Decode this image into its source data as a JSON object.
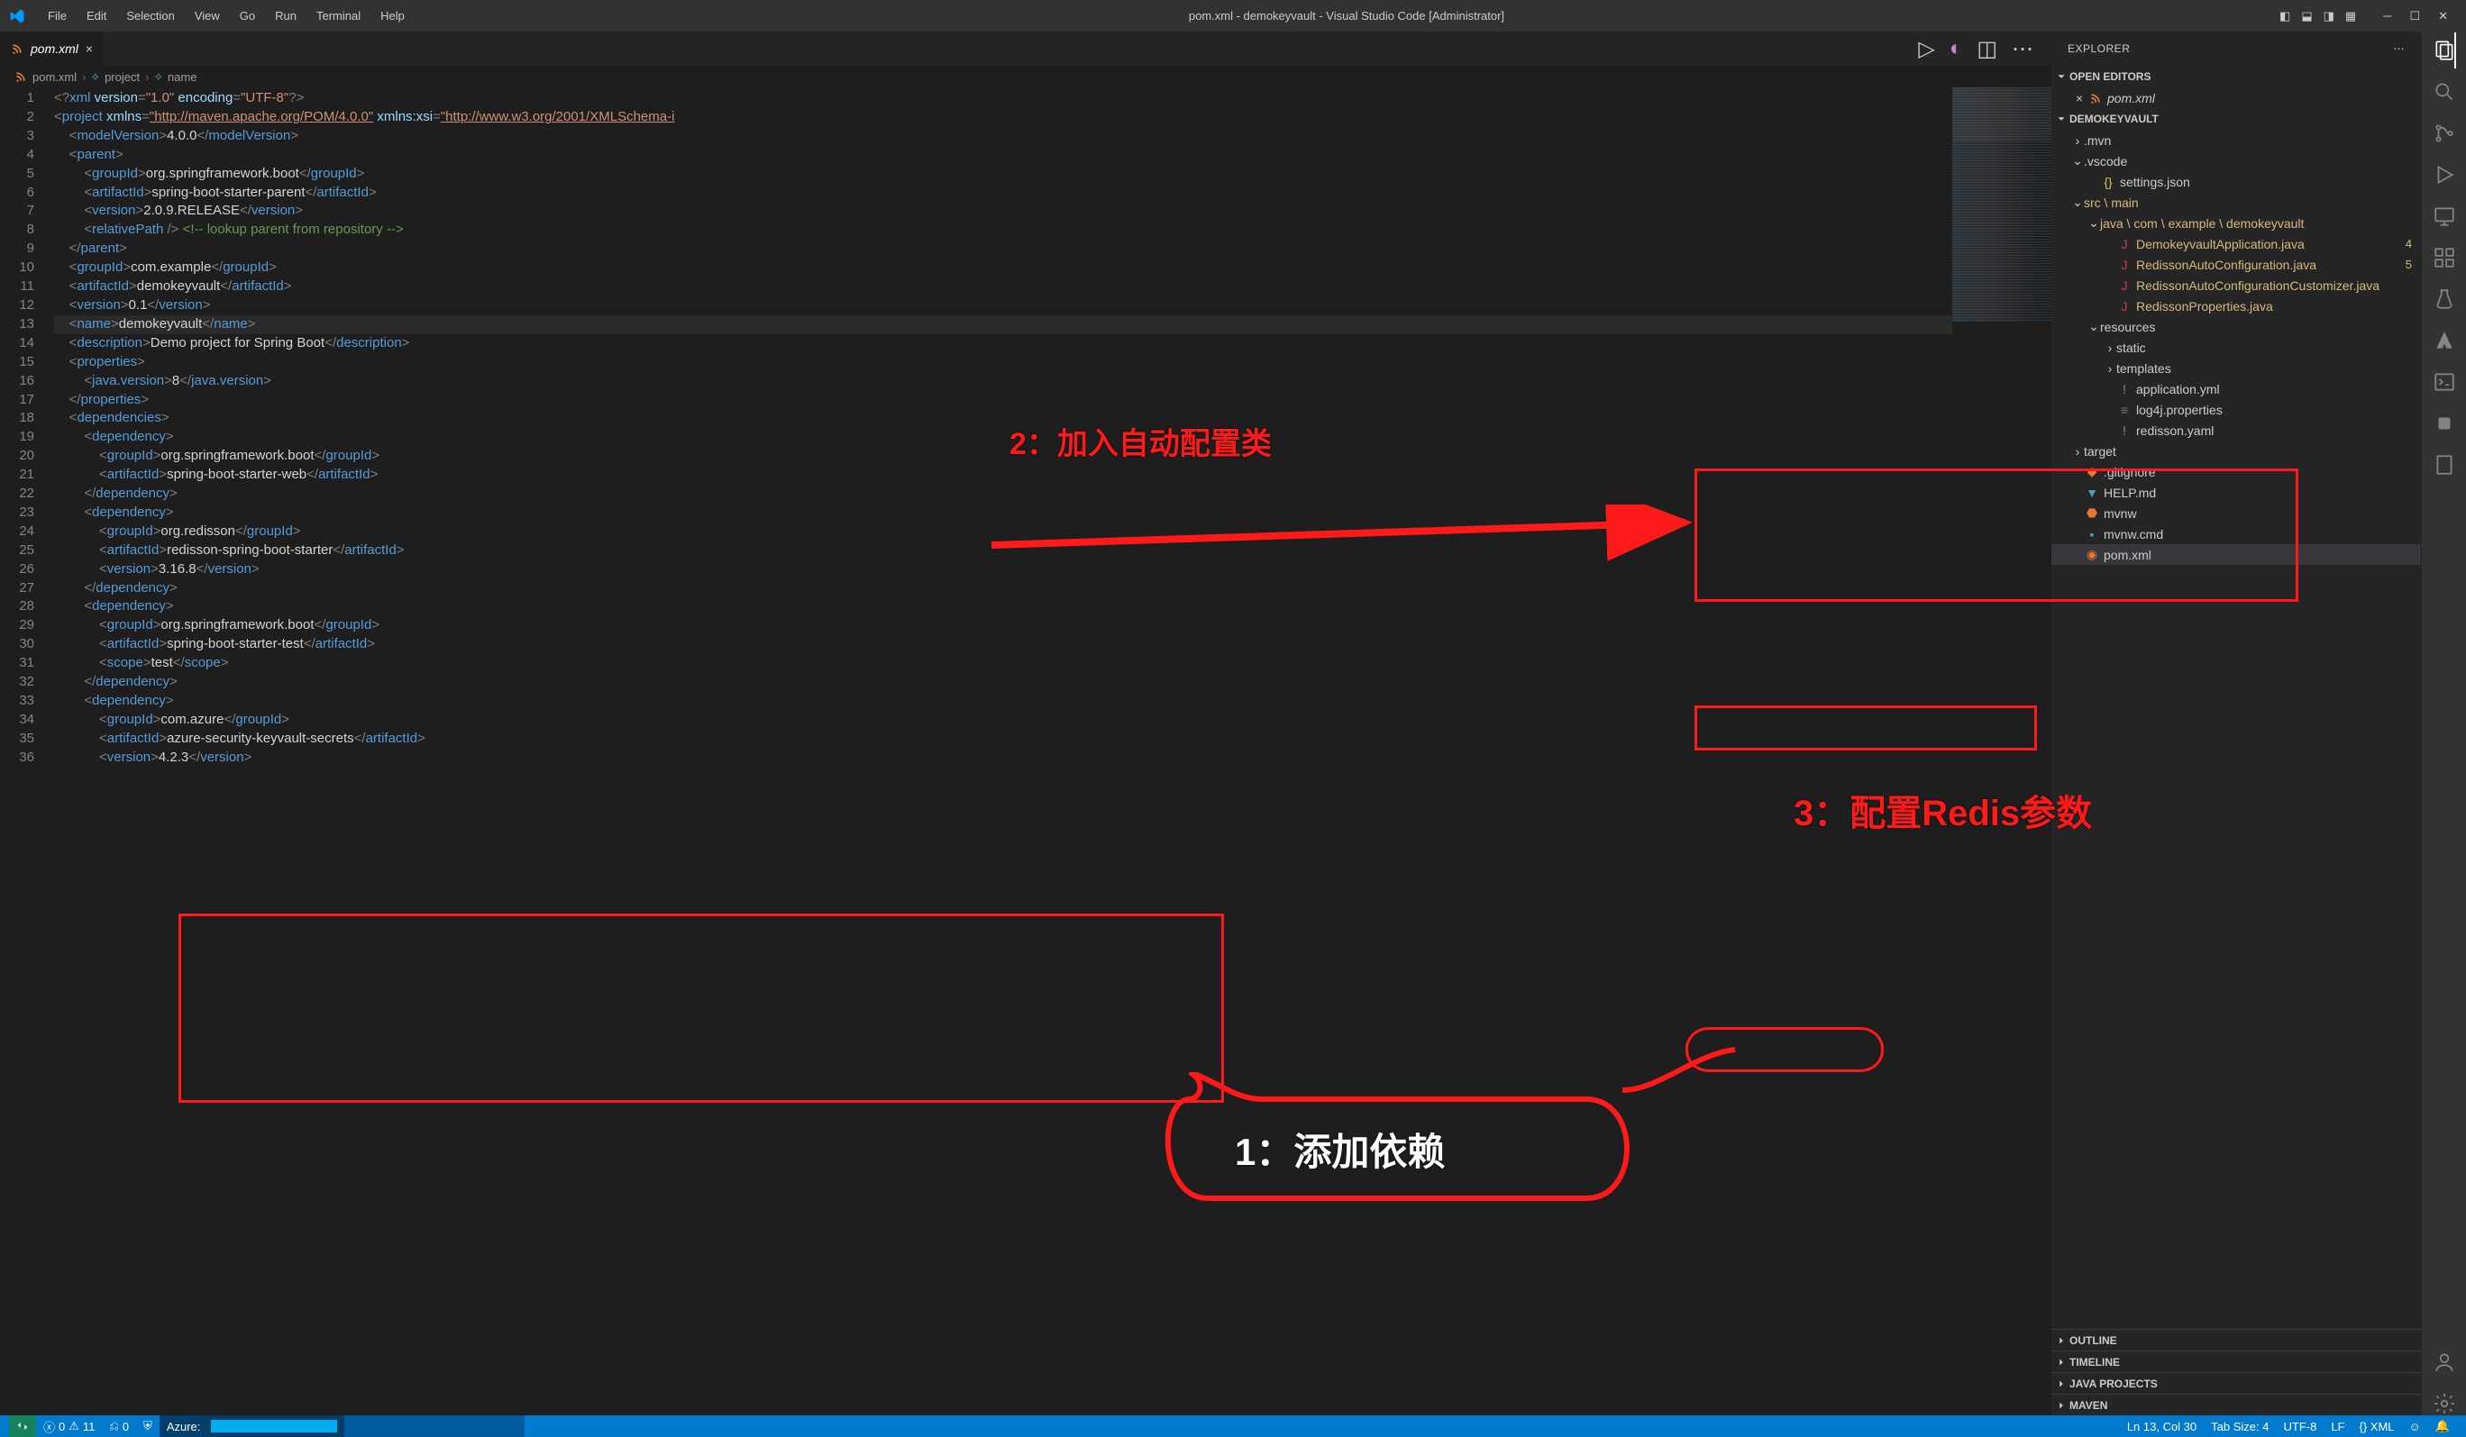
{
  "title_bar": {
    "menus": [
      "File",
      "Edit",
      "Selection",
      "View",
      "Go",
      "Run",
      "Terminal",
      "Help"
    ],
    "title": "pom.xml - demokeyvault - Visual Studio Code [Administrator]"
  },
  "tab": {
    "name": "pom.xml"
  },
  "tab_close": "×",
  "breadcrumb": {
    "file": "pom.xml",
    "node1": "project",
    "node2": "name"
  },
  "code": {
    "lines": [
      {
        "n": 1,
        "html": "<span class='tag-br'>&lt;?</span><span class='pi'>xml</span> <span class='attr-nm'>version</span><span class='tag-br'>=</span><span class='attr-vl'>\"1.0\"</span> <span class='attr-nm'>encoding</span><span class='tag-br'>=</span><span class='attr-vl'>\"UTF-8\"</span><span class='tag-br'>?&gt;</span>"
      },
      {
        "n": 2,
        "html": "<span class='tag-br'>&lt;</span><span class='tag-nm'>project</span> <span class='attr-nm'>xmlns</span><span class='tag-br'>=</span><span class='attr-vl string-link'>\"http://maven.apache.org/POM/4.0.0\"</span> <span class='attr-nm'>xmlns:xsi</span><span class='tag-br'>=</span><span class='attr-vl string-link'>\"http://www.w3.org/2001/XMLSchema-i</span>"
      },
      {
        "n": 3,
        "html": "    <span class='tag-br'>&lt;</span><span class='tag-nm'>modelVersion</span><span class='tag-br'>&gt;</span><span class='txt'>4.0.0</span><span class='tag-br'>&lt;/</span><span class='tag-nm'>modelVersion</span><span class='tag-br'>&gt;</span>"
      },
      {
        "n": 4,
        "html": "    <span class='tag-br'>&lt;</span><span class='tag-nm'>parent</span><span class='tag-br'>&gt;</span>"
      },
      {
        "n": 5,
        "html": "        <span class='tag-br'>&lt;</span><span class='tag-nm'>groupId</span><span class='tag-br'>&gt;</span><span class='txt'>org.springframework.boot</span><span class='tag-br'>&lt;/</span><span class='tag-nm'>groupId</span><span class='tag-br'>&gt;</span>"
      },
      {
        "n": 6,
        "html": "        <span class='tag-br'>&lt;</span><span class='tag-nm'>artifactId</span><span class='tag-br'>&gt;</span><span class='txt'>spring-boot-starter-parent</span><span class='tag-br'>&lt;/</span><span class='tag-nm'>artifactId</span><span class='tag-br'>&gt;</span>"
      },
      {
        "n": 7,
        "html": "        <span class='tag-br'>&lt;</span><span class='tag-nm'>version</span><span class='tag-br'>&gt;</span><span class='txt'>2.0.9.RELEASE</span><span class='tag-br'>&lt;/</span><span class='tag-nm'>version</span><span class='tag-br'>&gt;</span>"
      },
      {
        "n": 8,
        "html": "        <span class='tag-br'>&lt;</span><span class='tag-nm'>relativePath</span> <span class='tag-br'>/&gt;</span> <span class='comment'>&lt;!-- lookup parent from repository --&gt;</span>"
      },
      {
        "n": 9,
        "html": "    <span class='tag-br'>&lt;/</span><span class='tag-nm'>parent</span><span class='tag-br'>&gt;</span>"
      },
      {
        "n": 10,
        "html": "    <span class='tag-br'>&lt;</span><span class='tag-nm'>groupId</span><span class='tag-br'>&gt;</span><span class='txt'>com.example</span><span class='tag-br'>&lt;/</span><span class='tag-nm'>groupId</span><span class='tag-br'>&gt;</span>"
      },
      {
        "n": 11,
        "html": "    <span class='tag-br'>&lt;</span><span class='tag-nm'>artifactId</span><span class='tag-br'>&gt;</span><span class='txt'>demokeyvault</span><span class='tag-br'>&lt;/</span><span class='tag-nm'>artifactId</span><span class='tag-br'>&gt;</span>"
      },
      {
        "n": 12,
        "html": "    <span class='tag-br'>&lt;</span><span class='tag-nm'>version</span><span class='tag-br'>&gt;</span><span class='txt'>0.1</span><span class='tag-br'>&lt;/</span><span class='tag-nm'>version</span><span class='tag-br'>&gt;</span>"
      },
      {
        "n": 13,
        "hl": true,
        "html": "    <span class='tag-br'>&lt;</span><span class='tag-nm'>name</span><span class='tag-br'>&gt;</span><span class='txt'>demokeyvault</span><span class='tag-br'>&lt;/</span><span class='tag-nm'>name</span><span class='tag-br'>&gt;</span>"
      },
      {
        "n": 14,
        "html": "    <span class='tag-br'>&lt;</span><span class='tag-nm'>description</span><span class='tag-br'>&gt;</span><span class='txt'>Demo project for Spring Boot</span><span class='tag-br'>&lt;/</span><span class='tag-nm'>description</span><span class='tag-br'>&gt;</span>"
      },
      {
        "n": 15,
        "html": "    <span class='tag-br'>&lt;</span><span class='tag-nm'>properties</span><span class='tag-br'>&gt;</span>"
      },
      {
        "n": 16,
        "html": "        <span class='tag-br'>&lt;</span><span class='tag-nm'>java.version</span><span class='tag-br'>&gt;</span><span class='txt'>8</span><span class='tag-br'>&lt;/</span><span class='tag-nm'>java.version</span><span class='tag-br'>&gt;</span>"
      },
      {
        "n": 17,
        "html": "    <span class='tag-br'>&lt;/</span><span class='tag-nm'>properties</span><span class='tag-br'>&gt;</span>"
      },
      {
        "n": 18,
        "html": "    <span class='tag-br'>&lt;</span><span class='tag-nm'>dependencies</span><span class='tag-br'>&gt;</span>"
      },
      {
        "n": 19,
        "html": "        <span class='tag-br'>&lt;</span><span class='tag-nm'>dependency</span><span class='tag-br'>&gt;</span>"
      },
      {
        "n": 20,
        "html": "            <span class='tag-br'>&lt;</span><span class='tag-nm'>groupId</span><span class='tag-br'>&gt;</span><span class='txt'>org.springframework.boot</span><span class='tag-br'>&lt;/</span><span class='tag-nm'>groupId</span><span class='tag-br'>&gt;</span>"
      },
      {
        "n": 21,
        "html": "            <span class='tag-br'>&lt;</span><span class='tag-nm'>artifactId</span><span class='tag-br'>&gt;</span><span class='txt'>spring-boot-starter-web</span><span class='tag-br'>&lt;/</span><span class='tag-nm'>artifactId</span><span class='tag-br'>&gt;</span>"
      },
      {
        "n": 22,
        "html": "        <span class='tag-br'>&lt;/</span><span class='tag-nm'>dependency</span><span class='tag-br'>&gt;</span>"
      },
      {
        "n": 23,
        "html": "        <span class='tag-br'>&lt;</span><span class='tag-nm'>dependency</span><span class='tag-br'>&gt;</span>"
      },
      {
        "n": 24,
        "html": "            <span class='tag-br'>&lt;</span><span class='tag-nm'>groupId</span><span class='tag-br'>&gt;</span><span class='txt'>org.redisson</span><span class='tag-br'>&lt;/</span><span class='tag-nm'>groupId</span><span class='tag-br'>&gt;</span>"
      },
      {
        "n": 25,
        "html": "            <span class='tag-br'>&lt;</span><span class='tag-nm'>artifactId</span><span class='tag-br'>&gt;</span><span class='txt'>redisson-spring-boot-starter</span><span class='tag-br'>&lt;/</span><span class='tag-nm'>artifactId</span><span class='tag-br'>&gt;</span>"
      },
      {
        "n": 26,
        "html": "            <span class='tag-br'>&lt;</span><span class='tag-nm'>version</span><span class='tag-br'>&gt;</span><span class='txt'>3.16.8</span><span class='tag-br'>&lt;/</span><span class='tag-nm'>version</span><span class='tag-br'>&gt;</span>"
      },
      {
        "n": 27,
        "html": "        <span class='tag-br'>&lt;/</span><span class='tag-nm'>dependency</span><span class='tag-br'>&gt;</span>"
      },
      {
        "n": 28,
        "html": "        <span class='tag-br'>&lt;</span><span class='tag-nm'>dependency</span><span class='tag-br'>&gt;</span>"
      },
      {
        "n": 29,
        "html": "            <span class='tag-br'>&lt;</span><span class='tag-nm'>groupId</span><span class='tag-br'>&gt;</span><span class='txt'>org.springframework.boot</span><span class='tag-br'>&lt;/</span><span class='tag-nm'>groupId</span><span class='tag-br'>&gt;</span>"
      },
      {
        "n": 30,
        "html": "            <span class='tag-br'>&lt;</span><span class='tag-nm'>artifactId</span><span class='tag-br'>&gt;</span><span class='txt'>spring-boot-starter-test</span><span class='tag-br'>&lt;/</span><span class='tag-nm'>artifactId</span><span class='tag-br'>&gt;</span>"
      },
      {
        "n": 31,
        "html": "            <span class='tag-br'>&lt;</span><span class='tag-nm'>scope</span><span class='tag-br'>&gt;</span><span class='txt'>test</span><span class='tag-br'>&lt;/</span><span class='tag-nm'>scope</span><span class='tag-br'>&gt;</span>"
      },
      {
        "n": 32,
        "html": "        <span class='tag-br'>&lt;/</span><span class='tag-nm'>dependency</span><span class='tag-br'>&gt;</span>"
      },
      {
        "n": 33,
        "html": "        <span class='tag-br'>&lt;</span><span class='tag-nm'>dependency</span><span class='tag-br'>&gt;</span>"
      },
      {
        "n": 34,
        "html": "            <span class='tag-br'>&lt;</span><span class='tag-nm'>groupId</span><span class='tag-br'>&gt;</span><span class='txt'>com.azure</span><span class='tag-br'>&lt;/</span><span class='tag-nm'>groupId</span><span class='tag-br'>&gt;</span>"
      },
      {
        "n": 35,
        "html": "            <span class='tag-br'>&lt;</span><span class='tag-nm'>artifactId</span><span class='tag-br'>&gt;</span><span class='txt'>azure-security-keyvault-secrets</span><span class='tag-br'>&lt;/</span><span class='tag-nm'>artifactId</span><span class='tag-br'>&gt;</span>"
      },
      {
        "n": 36,
        "html": "            <span class='tag-br'>&lt;</span><span class='tag-nm'>version</span><span class='tag-br'>&gt;</span><span class='txt'>4.2.3</span><span class='tag-br'>&lt;/</span><span class='tag-nm'>version</span><span class='tag-br'>&gt;</span>"
      }
    ]
  },
  "explorer": {
    "title": "EXPLORER",
    "open_editors": "OPEN EDITORS",
    "open_item": "pom.xml",
    "project": "DEMOKEYVAULT",
    "tree": [
      {
        "d": 1,
        "t": "folder",
        "open": false,
        "label": ".mvn"
      },
      {
        "d": 1,
        "t": "folder",
        "open": true,
        "label": ".vscode"
      },
      {
        "d": 2,
        "t": "file",
        "icon": "json",
        "label": "settings.json"
      },
      {
        "d": 1,
        "t": "folder",
        "open": true,
        "mod": true,
        "label": "src \\ main",
        "badge": ""
      },
      {
        "d": 2,
        "t": "folder",
        "open": true,
        "mod": true,
        "label": "java \\ com \\ example \\ demokeyvault"
      },
      {
        "d": 3,
        "t": "file",
        "icon": "java",
        "mod": true,
        "label": "DemokeyvaultApplication.java",
        "badge": "4"
      },
      {
        "d": 3,
        "t": "file",
        "icon": "java",
        "mod": true,
        "label": "RedissonAutoConfiguration.java",
        "badge": "5"
      },
      {
        "d": 3,
        "t": "file",
        "icon": "java",
        "mod": true,
        "label": "RedissonAutoConfigurationCustomizer.java"
      },
      {
        "d": 3,
        "t": "file",
        "icon": "java",
        "mod": true,
        "label": "RedissonProperties.java"
      },
      {
        "d": 2,
        "t": "folder",
        "open": true,
        "label": "resources"
      },
      {
        "d": 3,
        "t": "folder",
        "open": false,
        "label": "static"
      },
      {
        "d": 3,
        "t": "folder",
        "open": false,
        "label": "templates"
      },
      {
        "d": 3,
        "t": "file",
        "icon": "yaml",
        "label": "application.yml"
      },
      {
        "d": 3,
        "t": "file",
        "icon": "log",
        "label": "log4j.properties"
      },
      {
        "d": 3,
        "t": "file",
        "icon": "yaml",
        "label": "redisson.yaml"
      },
      {
        "d": 1,
        "t": "folder",
        "open": false,
        "label": "target"
      },
      {
        "d": 1,
        "t": "file",
        "icon": "git",
        "label": ".gitignore"
      },
      {
        "d": 1,
        "t": "file",
        "icon": "md",
        "label": "HELP.md"
      },
      {
        "d": 1,
        "t": "file",
        "icon": "sh",
        "label": "mvnw"
      },
      {
        "d": 1,
        "t": "file",
        "icon": "cmd",
        "label": "mvnw.cmd"
      },
      {
        "d": 1,
        "t": "file",
        "icon": "rss",
        "label": "pom.xml",
        "selected": true
      }
    ],
    "sections": [
      "OUTLINE",
      "TIMELINE",
      "JAVA PROJECTS",
      "MAVEN"
    ]
  },
  "status": {
    "remote": "",
    "errors": "0",
    "warnings": "11",
    "ports": "0",
    "azure": "Azure:",
    "lncol": "Ln 13, Col 30",
    "tabsize": "Tab Size: 4",
    "enc": "UTF-8",
    "eol": "LF",
    "lang": "{} XML"
  },
  "annotations": {
    "a1": "1：添加依赖",
    "a2": "2：加入自动配置类",
    "a3": "3：配置Redis参数"
  }
}
